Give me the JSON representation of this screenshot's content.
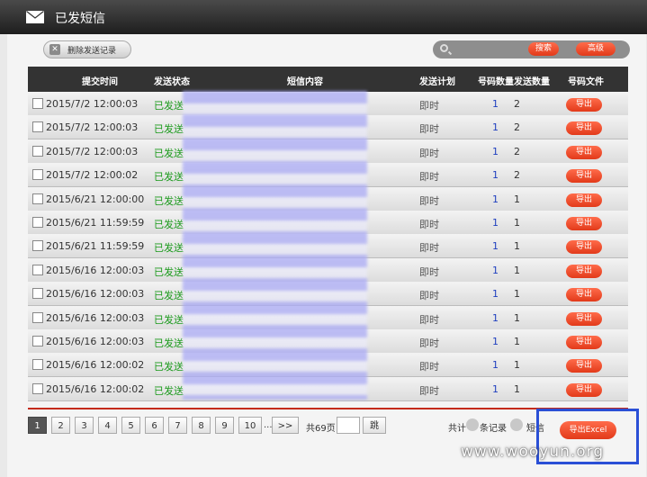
{
  "window": {
    "title": "已发短信"
  },
  "toolbar": {
    "delete_label": "删除发送记录",
    "search_placeholder": "",
    "search_label": "搜索",
    "advanced_label": "高级"
  },
  "table": {
    "headers": [
      "提交时间",
      "发送状态",
      "短信内容",
      "发送计划",
      "号码数量",
      "发送数量",
      "号码文件"
    ],
    "rows": [
      {
        "time": "2015/7/2 12:00:03",
        "status": "已发送",
        "plan": "即时",
        "count": "1",
        "sent": "2",
        "action": "导出"
      },
      {
        "time": "2015/7/2 12:00:03",
        "status": "已发送",
        "plan": "即时",
        "count": "1",
        "sent": "2",
        "action": "导出"
      },
      {
        "time": "2015/7/2 12:00:03",
        "status": "已发送",
        "plan": "即时",
        "count": "1",
        "sent": "2",
        "action": "导出"
      },
      {
        "time": "2015/7/2 12:00:02",
        "status": "已发送",
        "plan": "即时",
        "count": "1",
        "sent": "2",
        "action": "导出"
      },
      {
        "time": "2015/6/21 12:00:00",
        "status": "已发送",
        "plan": "即时",
        "count": "1",
        "sent": "1",
        "action": "导出"
      },
      {
        "time": "2015/6/21 11:59:59",
        "status": "已发送",
        "plan": "即时",
        "count": "1",
        "sent": "1",
        "action": "导出"
      },
      {
        "time": "2015/6/21 11:59:59",
        "status": "已发送",
        "plan": "即时",
        "count": "1",
        "sent": "1",
        "action": "导出"
      },
      {
        "time": "2015/6/16 12:00:03",
        "status": "已发送",
        "plan": "即时",
        "count": "1",
        "sent": "1",
        "action": "导出"
      },
      {
        "time": "2015/6/16 12:00:03",
        "status": "已发送",
        "plan": "即时",
        "count": "1",
        "sent": "1",
        "action": "导出"
      },
      {
        "time": "2015/6/16 12:00:03",
        "status": "已发送",
        "plan": "即时",
        "count": "1",
        "sent": "1",
        "action": "导出"
      },
      {
        "time": "2015/6/16 12:00:03",
        "status": "已发送",
        "plan": "即时",
        "count": "1",
        "sent": "1",
        "action": "导出"
      },
      {
        "time": "2015/6/16 12:00:02",
        "status": "已发送",
        "plan": "即时",
        "count": "1",
        "sent": "1",
        "action": "导出"
      },
      {
        "time": "2015/6/16 12:00:02",
        "status": "已发送",
        "plan": "即时",
        "count": "1",
        "sent": "1",
        "action": "导出"
      }
    ]
  },
  "pagination": {
    "pages": [
      "1",
      "2",
      "3",
      "4",
      "5",
      "6",
      "7",
      "8",
      "9",
      "10"
    ],
    "ellipsis": "...",
    "next": ">>",
    "total_pages": "共69页",
    "jump_label": "跳"
  },
  "footer": {
    "total_prefix": "共计",
    "records_suffix": "条记录",
    "sms_suffix": "短信",
    "export_excel_label": "导出Excel"
  },
  "watermark": "www.wooyun.org",
  "colors": {
    "accent": "#e84a2a",
    "status_green": "#1a9a1a",
    "highlight_box": "#2a4fd6",
    "header_bg": "#333333"
  }
}
